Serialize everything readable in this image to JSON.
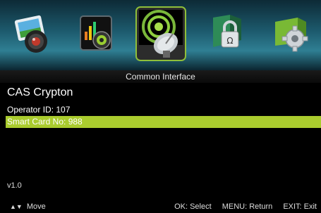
{
  "menu": {
    "icons": [
      {
        "name": "picture-icon",
        "selected": false
      },
      {
        "name": "sound-icon",
        "selected": false
      },
      {
        "name": "channel-dish-icon",
        "selected": true
      },
      {
        "name": "lock-icon",
        "selected": false
      },
      {
        "name": "settings-icon",
        "selected": false
      }
    ],
    "section_title": "Common Interface"
  },
  "module": {
    "name": "CAS Crypton",
    "rows": [
      {
        "label": "Operator ID: 107",
        "selected": false
      },
      {
        "label": "Smart Card No: 988",
        "selected": true
      }
    ],
    "version": "v1.0"
  },
  "help": {
    "move_icon": "up-down-arrows-icon",
    "move": "Move",
    "ok": "OK: Select",
    "menu": "MENU: Return",
    "exit": "EXIT: Exit"
  },
  "colors": {
    "highlight": "#aacc2e",
    "bar_teal": "#2f7f93"
  }
}
